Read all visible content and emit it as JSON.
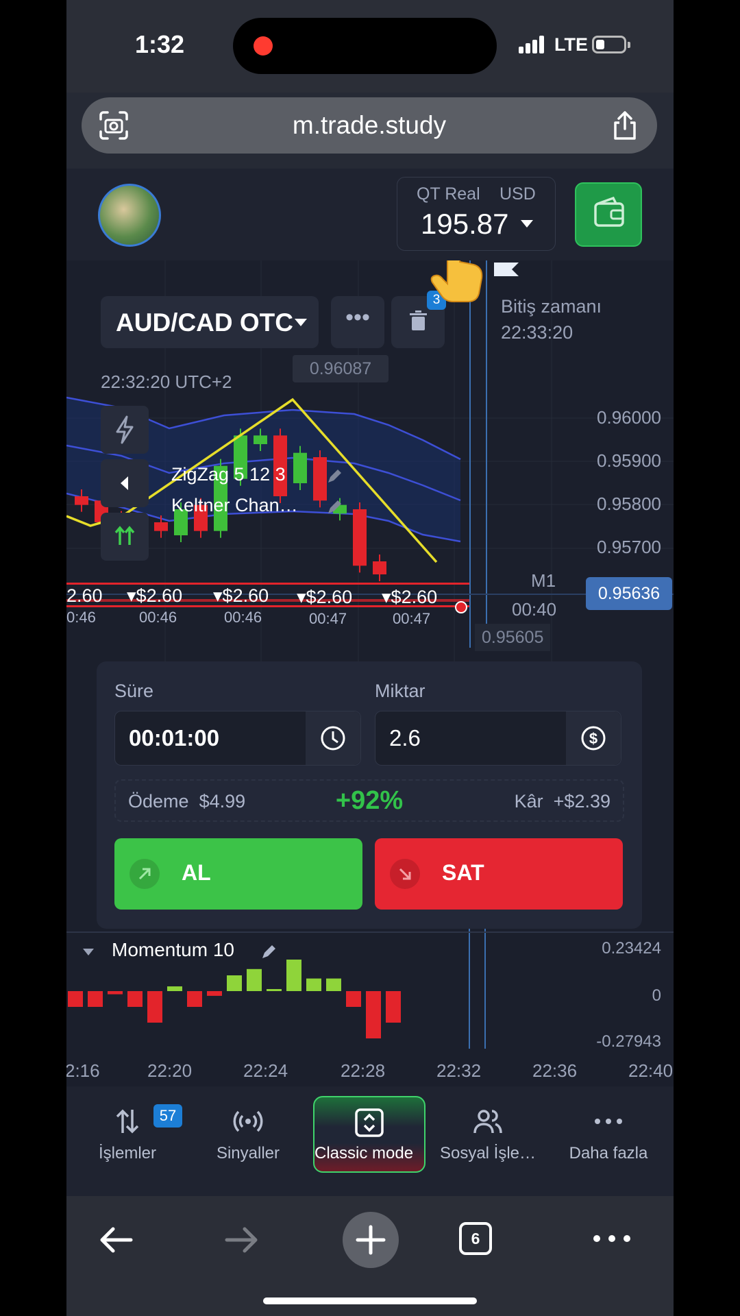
{
  "status": {
    "time": "1:32",
    "network": "LTE"
  },
  "browser": {
    "url": "m.trade.study",
    "tab_count": "6"
  },
  "header": {
    "account_type": "QT Real",
    "currency": "USD",
    "balance": "195.87"
  },
  "chart": {
    "asset": "AUD/CAD OTC",
    "more_label": "•••",
    "trash_badge": "3",
    "hover_price": "0.96087",
    "server_time": "22:32:20 UTC+2",
    "expiry_label": "Bitiş zamanı",
    "expiry_time": "22:33:20",
    "y_ticks": [
      "0.96000",
      "0.95900",
      "0.95800",
      "0.95700"
    ],
    "current_price": "0.95636",
    "timeframe": "M1",
    "countdown": "00:40",
    "low_price": "0.95605",
    "indicators": [
      "ZigZag 5 12 3",
      "Keltner Chan…"
    ],
    "trades": [
      {
        "amount": "2.60",
        "time": "0:46"
      },
      {
        "amount": "▾$2.60",
        "time": "00:46"
      },
      {
        "amount": "▾$2.60",
        "time": "00:46"
      },
      {
        "amount": "▾$2.60",
        "time": "00:47"
      },
      {
        "amount": "▾$2.60",
        "time": "00:47"
      }
    ]
  },
  "chart_data": {
    "type": "candlestick",
    "title": "",
    "y_ticks": [
      0.96,
      0.959,
      0.958,
      0.957
    ],
    "current_price": 0.95636,
    "candles": [
      {
        "dir": "down",
        "o": 0.9582,
        "c": 0.958
      },
      {
        "dir": "down",
        "o": 0.9581,
        "c": 0.9576
      },
      {
        "dir": "down",
        "o": 0.9577,
        "c": 0.9575
      },
      {
        "dir": "up",
        "o": 0.9573,
        "c": 0.9574
      },
      {
        "dir": "down",
        "o": 0.9576,
        "c": 0.9574
      },
      {
        "dir": "up",
        "o": 0.9573,
        "c": 0.9579
      },
      {
        "dir": "down",
        "o": 0.958,
        "c": 0.9574
      },
      {
        "dir": "up",
        "o": 0.9574,
        "c": 0.9589
      },
      {
        "dir": "up",
        "o": 0.9586,
        "c": 0.9596
      },
      {
        "dir": "up",
        "o": 0.9594,
        "c": 0.9596
      },
      {
        "dir": "down",
        "o": 0.9596,
        "c": 0.9582
      },
      {
        "dir": "up",
        "o": 0.9585,
        "c": 0.9592
      },
      {
        "dir": "down",
        "o": 0.9591,
        "c": 0.9581
      },
      {
        "dir": "up",
        "o": 0.9578,
        "c": 0.958
      },
      {
        "dir": "down",
        "o": 0.9579,
        "c": 0.9566
      },
      {
        "dir": "down",
        "o": 0.9567,
        "c": 0.9564
      }
    ],
    "momentum": {
      "label": "Momentum 10",
      "y_ticks": [
        "0.23424",
        "0",
        "-0.27943"
      ],
      "values": [
        -0.1,
        -0.1,
        -0.02,
        -0.1,
        -0.2,
        0.03,
        -0.1,
        -0.03,
        0.1,
        0.14,
        0.01,
        0.2,
        0.08,
        0.08,
        -0.1,
        -0.3,
        -0.2
      ]
    },
    "x_ticks": [
      "2:16",
      "22:20",
      "22:24",
      "22:28",
      "22:32",
      "22:36",
      "22:40"
    ]
  },
  "panel": {
    "duration_label": "Süre",
    "duration_value": "00:01:00",
    "amount_label": "Miktar",
    "amount_value": "2.6",
    "payout_label": "Ödeme",
    "payout_value": "$4.99",
    "payout_pct": "+92%",
    "profit_label": "Kâr",
    "profit_value": "+$2.39",
    "buy_label": "AL",
    "sell_label": "SAT"
  },
  "nav": {
    "items": [
      {
        "label": "İşlemler",
        "badge": "57",
        "icon": "trades-arrows-icon"
      },
      {
        "label": "Sinyaller",
        "icon": "signal-broadcast-icon"
      },
      {
        "label": "Classic mode",
        "icon": "mode-toggle-icon"
      },
      {
        "label": "Sosyal İşle…",
        "icon": "users-icon"
      },
      {
        "label": "Daha fazla",
        "icon": "more-dots-icon"
      }
    ]
  },
  "colors": {
    "up": "#3fbf3a",
    "down": "#e3242b",
    "accent_green": "#3cc348",
    "accent_red": "#e52632",
    "bg": "#1b1f2c"
  }
}
